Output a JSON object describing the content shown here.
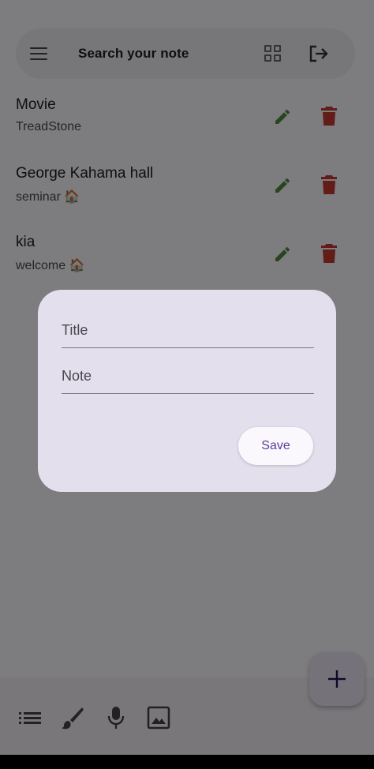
{
  "search": {
    "text": "Search your note",
    "menu_icon": "menu-icon",
    "grid_icon": "grid-view-icon",
    "logout_icon": "logout-icon"
  },
  "notes": [
    {
      "title": "Movie",
      "subtitle": "TreadStone"
    },
    {
      "title": "George Kahama hall",
      "subtitle": "seminar 🏠"
    },
    {
      "title": "kia",
      "subtitle": "welcome 🏠"
    }
  ],
  "dialog": {
    "title_placeholder": "Title",
    "note_placeholder": "Note",
    "save_label": "Save"
  },
  "bottom_bar": {
    "icons": [
      "checklist-icon",
      "brush-icon",
      "mic-icon",
      "image-icon"
    ],
    "fab_icon": "add-icon"
  },
  "colors": {
    "edit": "#4f8a3f",
    "delete": "#c53a33",
    "accent": "#5b3f9e"
  }
}
